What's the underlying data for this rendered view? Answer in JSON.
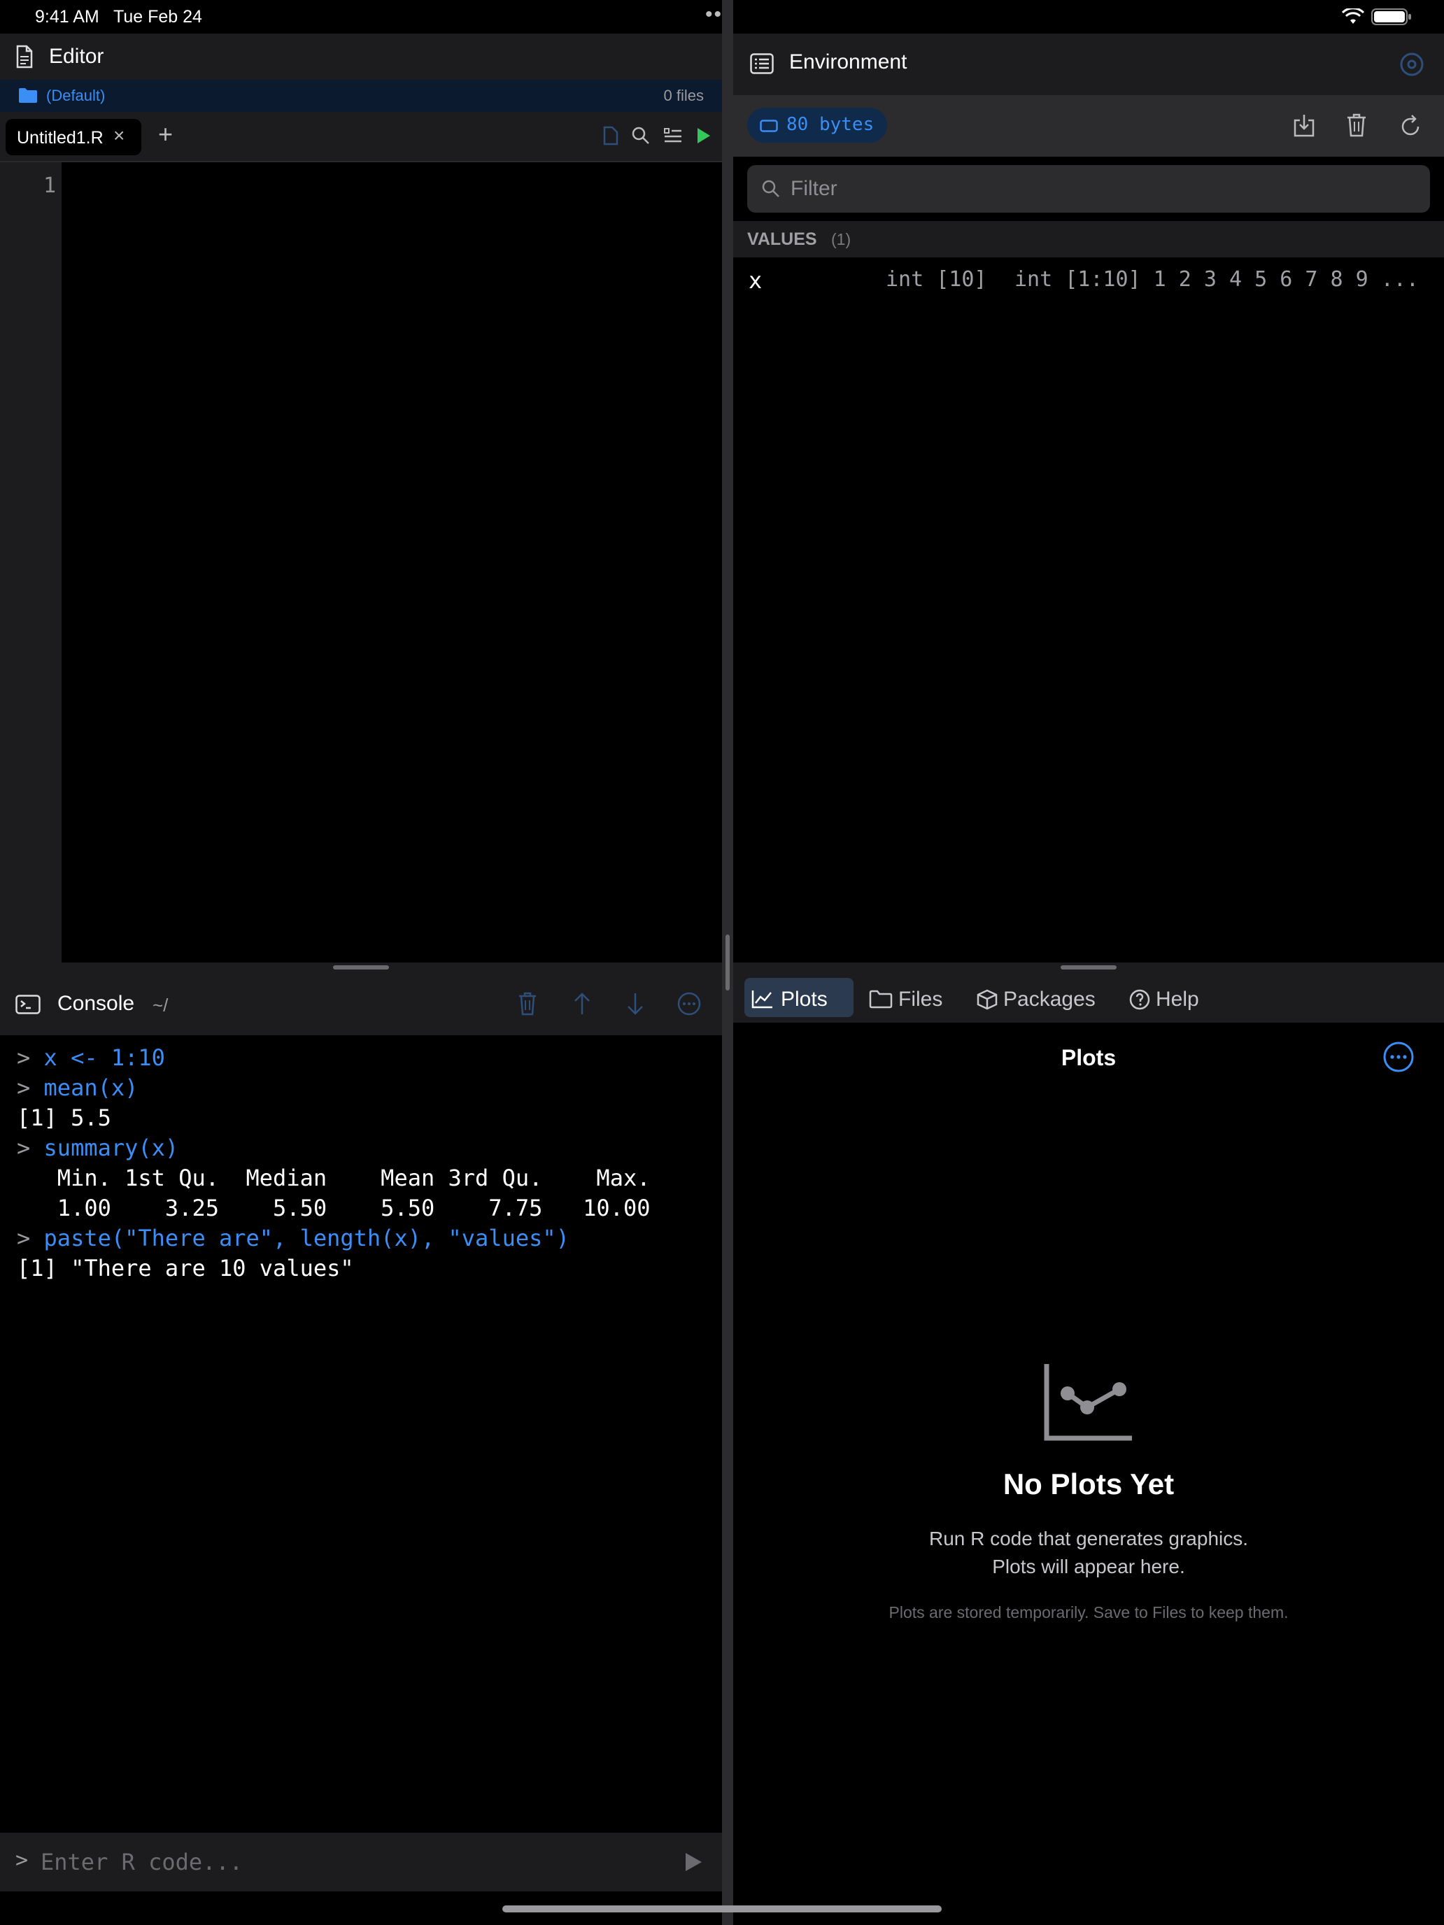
{
  "status_bar": {
    "time": "9:41 AM",
    "date": "Tue Feb 24"
  },
  "editor": {
    "title": "Editor",
    "folder": {
      "name": "(Default)",
      "count": "0 files"
    },
    "tab": {
      "label": "Untitled1.R",
      "close": "×"
    },
    "add_tab": "+",
    "line_numbers": [
      "1"
    ]
  },
  "console": {
    "title": "Console",
    "path": "~/",
    "lines": [
      {
        "prompt": ">",
        "code": "x <- 1:10"
      },
      {
        "prompt": ">",
        "code": "mean(x)"
      },
      {
        "output": "[1] 5.5"
      },
      {
        "prompt": ">",
        "code": "summary(x)"
      },
      {
        "output": "   Min. 1st Qu.  Median    Mean 3rd Qu.    Max. "
      },
      {
        "output": "   1.00    3.25    5.50    5.50    7.75   10.00 "
      },
      {
        "prompt": ">",
        "code": "paste(\"There are\", length(x), \"values\")"
      },
      {
        "output": "[1] \"There are 10 values\""
      }
    ],
    "input_prompt": ">",
    "input_placeholder": "Enter R code..."
  },
  "environment": {
    "title": "Environment",
    "memory": "80 bytes",
    "filter_placeholder": "Filter",
    "values_label": "VALUES",
    "values_count": "(1)",
    "variables": [
      {
        "name": "x",
        "type": "int [10]",
        "value": "int [1:10] 1 2 3 4 5 6 7 8 9 ..."
      }
    ]
  },
  "bottom_tabs": [
    {
      "label": "Plots",
      "icon": "chart-icon"
    },
    {
      "label": "Files",
      "icon": "folder-icon"
    },
    {
      "label": "Packages",
      "icon": "package-icon"
    },
    {
      "label": "Help",
      "icon": "help-icon"
    }
  ],
  "plots": {
    "title": "Plots",
    "empty_title": "No Plots Yet",
    "empty_line1": "Run R code that generates graphics.",
    "empty_line2": "Plots will appear here.",
    "note": "Plots are stored temporarily. Save to Files to keep them."
  },
  "colors": {
    "accent": "#3a8ef6",
    "run_green": "#34c759",
    "panel": "#1c1c1e",
    "background": "#000000"
  }
}
